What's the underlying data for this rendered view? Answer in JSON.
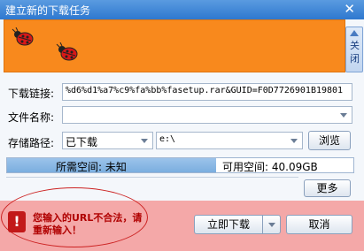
{
  "window": {
    "title": "建立新的下载任务",
    "close_glyph": "✕"
  },
  "side_tab": {
    "label": "关闭"
  },
  "form": {
    "url_label": "下载链接:",
    "url_value": "%d6%d1%a7%c9%fa%bb%fasetup.rar&GUID=F0D7726901B19801",
    "name_label": "文件名称:",
    "name_value": "",
    "path_label": "存储路径:",
    "category_value": "已下载",
    "path_value": "e:\\",
    "browse_label": "浏览"
  },
  "space": {
    "required": "所需空间: 未知",
    "available": "可用空间: 40.09GB",
    "more_label": "更多"
  },
  "error": {
    "icon_glyph": "!",
    "message": "您输入的URL不合法，请重新输入！"
  },
  "actions": {
    "download_now": "立即下载",
    "cancel": "取消"
  },
  "colors": {
    "banner": "#f8891d",
    "titlebar": "#2e78cf",
    "error_bg": "#f4a8a8",
    "error_text": "#b00000"
  },
  "icons": [
    "ladybug-icon",
    "ladybug-icon",
    "close-icon",
    "collapse-triangle-icon",
    "chevron-down-icon",
    "error-icon"
  ]
}
